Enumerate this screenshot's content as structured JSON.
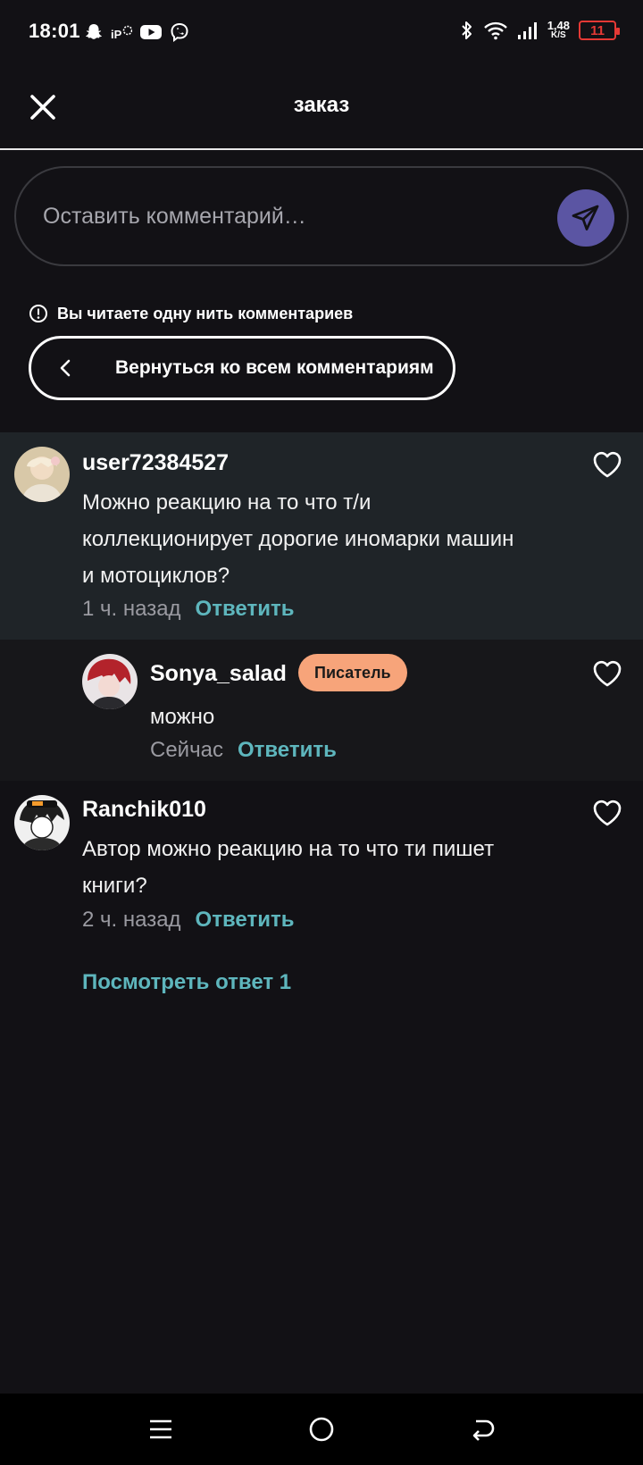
{
  "status_bar": {
    "time": "18:01",
    "net_speed_value": "1,48",
    "net_speed_unit": "K/S",
    "battery_level": "11",
    "left_icons": [
      "snapchat-icon",
      "ip-icon",
      "youtube-icon",
      "viber-icon"
    ],
    "right_icons": [
      "bluetooth-icon",
      "wifi-icon",
      "signal-icon",
      "battery-icon"
    ],
    "battery_color": "#e53935"
  },
  "header": {
    "title": "заказ",
    "close_icon": "close-icon"
  },
  "comment_input": {
    "placeholder": "Оставить комментарий…",
    "send_icon": "send-icon",
    "send_color": "#5b55a3"
  },
  "thread": {
    "notice": "Вы читаете одну нить комментариев",
    "back_label": "Вернуться ко всем комментариям"
  },
  "comments": [
    {
      "username": "user72384527",
      "lines": [
        "Можно реакцию на то что т/и",
        "коллекционирует дорогие иномарки машин",
        "и мотоциклов?"
      ],
      "time": "1 ч. назад",
      "reply": "Ответить"
    },
    {
      "username": "Sonya_salad",
      "badge": "Писатель",
      "lines": [
        "можно"
      ],
      "time": "Сейчас",
      "reply": "Ответить"
    },
    {
      "username": "Ranchik010",
      "lines": [
        "Автор можно реакцию на то что ти пишет",
        "книги?"
      ],
      "time": "2 ч. назад",
      "reply": "Ответить"
    }
  ],
  "view_replies": "Посмотреть ответ 1",
  "colors": {
    "accent": "#5eb6bd",
    "badge": "#f7a47a",
    "highlight_bg": "#1f2428"
  },
  "nav_bar": {
    "icons": [
      "menu-icon",
      "home-icon",
      "back-icon"
    ]
  }
}
